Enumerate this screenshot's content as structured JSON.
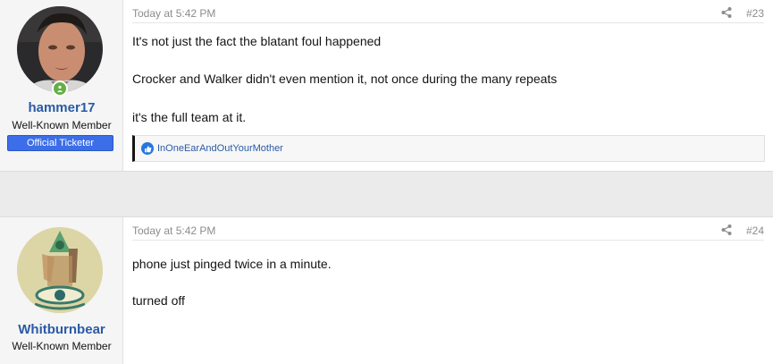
{
  "posts": [
    {
      "username": "hammer17",
      "user_title": "Well-Known Member",
      "banner": "Official Ticketer",
      "time": "Today at 5:42 PM",
      "post_number": "#23",
      "lines": [
        "It's not just the fact the blatant foul happened",
        "Crocker and Walker didn't even mention it, not once during the many repeats",
        "it's the full team at it."
      ],
      "reactions": {
        "icon": "thumbs-up-icon",
        "users": "InOneEarAndOutYourMother"
      },
      "online": true
    },
    {
      "username": "Whitburnbear",
      "user_title": "Well-Known Member",
      "time": "Today at 5:42 PM",
      "post_number": "#24",
      "lines": [
        "phone just pinged twice in a minute.",
        "turned off"
      ]
    }
  ],
  "colors": {
    "username": "#2a5aa6",
    "banner": "#3b6ee8",
    "online": "#63b045",
    "like": "#2577e0"
  }
}
